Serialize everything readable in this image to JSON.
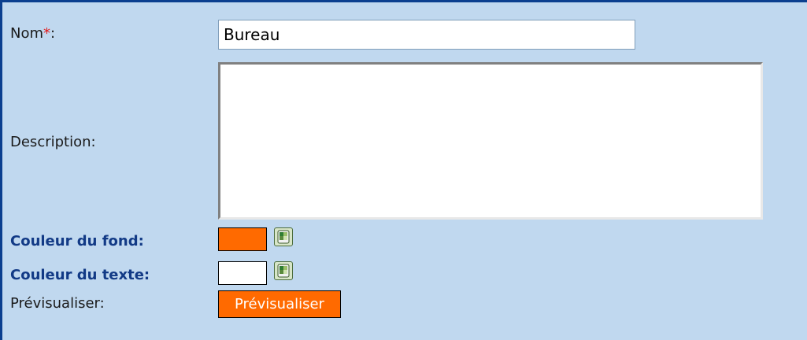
{
  "form": {
    "name": {
      "label": "Nom",
      "required_mark": "*",
      "suffix": ":",
      "value": "Bureau"
    },
    "description": {
      "label": "Description:",
      "value": ""
    },
    "background_color": {
      "label": "Couleur du fond:",
      "color": "#ff6a00",
      "picker_icon": "color-picker-icon"
    },
    "text_color": {
      "label": "Couleur du texte:",
      "color": "#ffffff",
      "picker_icon": "color-picker-icon"
    },
    "preview": {
      "label": "Prévisualiser:",
      "button_label": "Prévisualiser"
    }
  },
  "colors": {
    "panel_background": "#c0d8ef",
    "panel_border": "#0b3f8f",
    "label_bold": "#123a86",
    "required": "#e21b1b",
    "preview_button": "#ff6a00"
  }
}
